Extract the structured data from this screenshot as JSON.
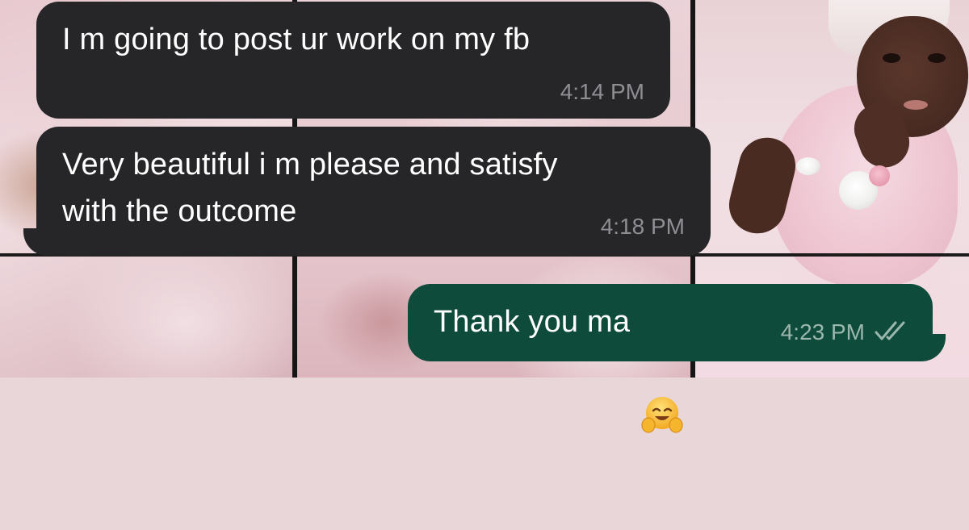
{
  "conversation": {
    "messages": [
      {
        "direction": "incoming",
        "text": "I m going to post ur work on my fb",
        "time": "4:14 PM"
      },
      {
        "direction": "incoming",
        "text": "Very beautiful i m please and satisfy\nwith the outcome",
        "time": "4:18 PM"
      },
      {
        "direction": "outgoing",
        "text": "Thank you ma",
        "emoji": "hugging-face-icon",
        "time": "4:23 PM",
        "status_icon": "double-check-icon"
      }
    ]
  },
  "colors": {
    "incoming_bubble": "#262629",
    "outgoing_bubble": "#0f4b3b",
    "message_text": "#ffffff",
    "timestamp_incoming": "#8e8e93",
    "timestamp_outgoing": "#9bb7ad"
  }
}
